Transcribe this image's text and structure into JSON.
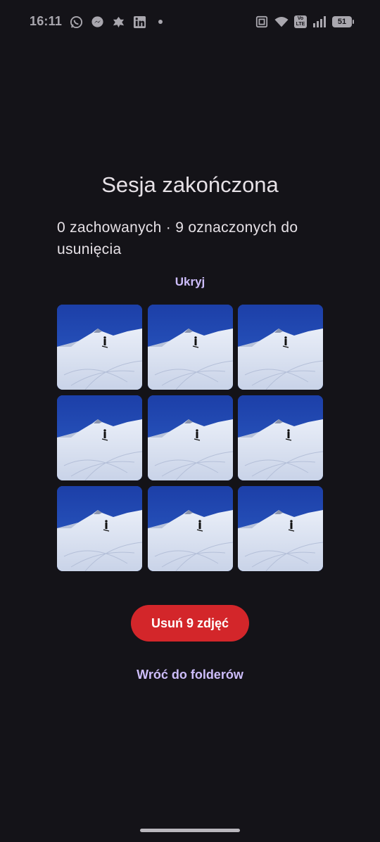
{
  "status_bar": {
    "time": "16:11",
    "left_icons": [
      "whatsapp-icon",
      "messenger-icon",
      "app-notification-icon",
      "linkedin-icon",
      "more-dot-icon"
    ],
    "right_icons": [
      "nfc-icon",
      "wifi-icon",
      "volte-icon",
      "signal-icon",
      "battery-icon"
    ],
    "volte_top": "Vo",
    "volte_bottom": "LTE",
    "battery_level": "51"
  },
  "screen": {
    "title": "Sesja zakończona",
    "summary": "0 zachowanych · 9 oznaczonych do usunięcia",
    "hide_label": "Ukryj",
    "photos": [
      {
        "id": 1
      },
      {
        "id": 2
      },
      {
        "id": 3
      },
      {
        "id": 4
      },
      {
        "id": 5
      },
      {
        "id": 6
      },
      {
        "id": 7
      },
      {
        "id": 8
      },
      {
        "id": 9
      }
    ],
    "delete_label": "Usuń 9 zdjęć",
    "back_label": "Wróć do folderów"
  },
  "colors": {
    "background": "#141318",
    "accent_link": "#cdbdfa",
    "delete_button": "#d3262a",
    "text": "#e6e1e6"
  }
}
